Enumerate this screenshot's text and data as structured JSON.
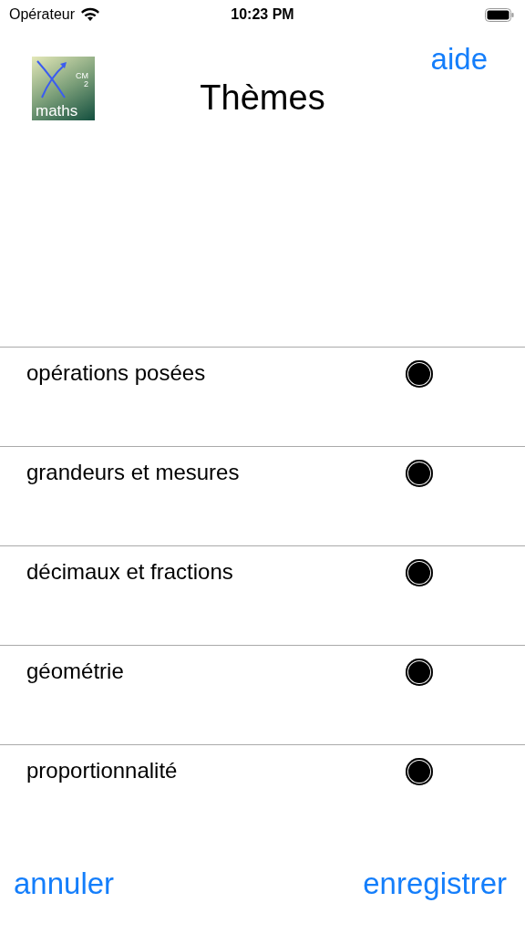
{
  "status_bar": {
    "carrier": "Opérateur",
    "time": "10:23 PM"
  },
  "header": {
    "logo": {
      "label": "maths",
      "grade": "CM",
      "grade_number": "2"
    },
    "title": "Thèmes",
    "help_link": "aide"
  },
  "themes": [
    {
      "label": "opérations posées",
      "on": true
    },
    {
      "label": "grandeurs et mesures",
      "on": true
    },
    {
      "label": "décimaux et fractions",
      "on": true
    },
    {
      "label": "géométrie",
      "on": true
    },
    {
      "label": "proportionnalité",
      "on": true
    }
  ],
  "buttons": {
    "cancel": "annuler",
    "save": "enregistrer"
  }
}
